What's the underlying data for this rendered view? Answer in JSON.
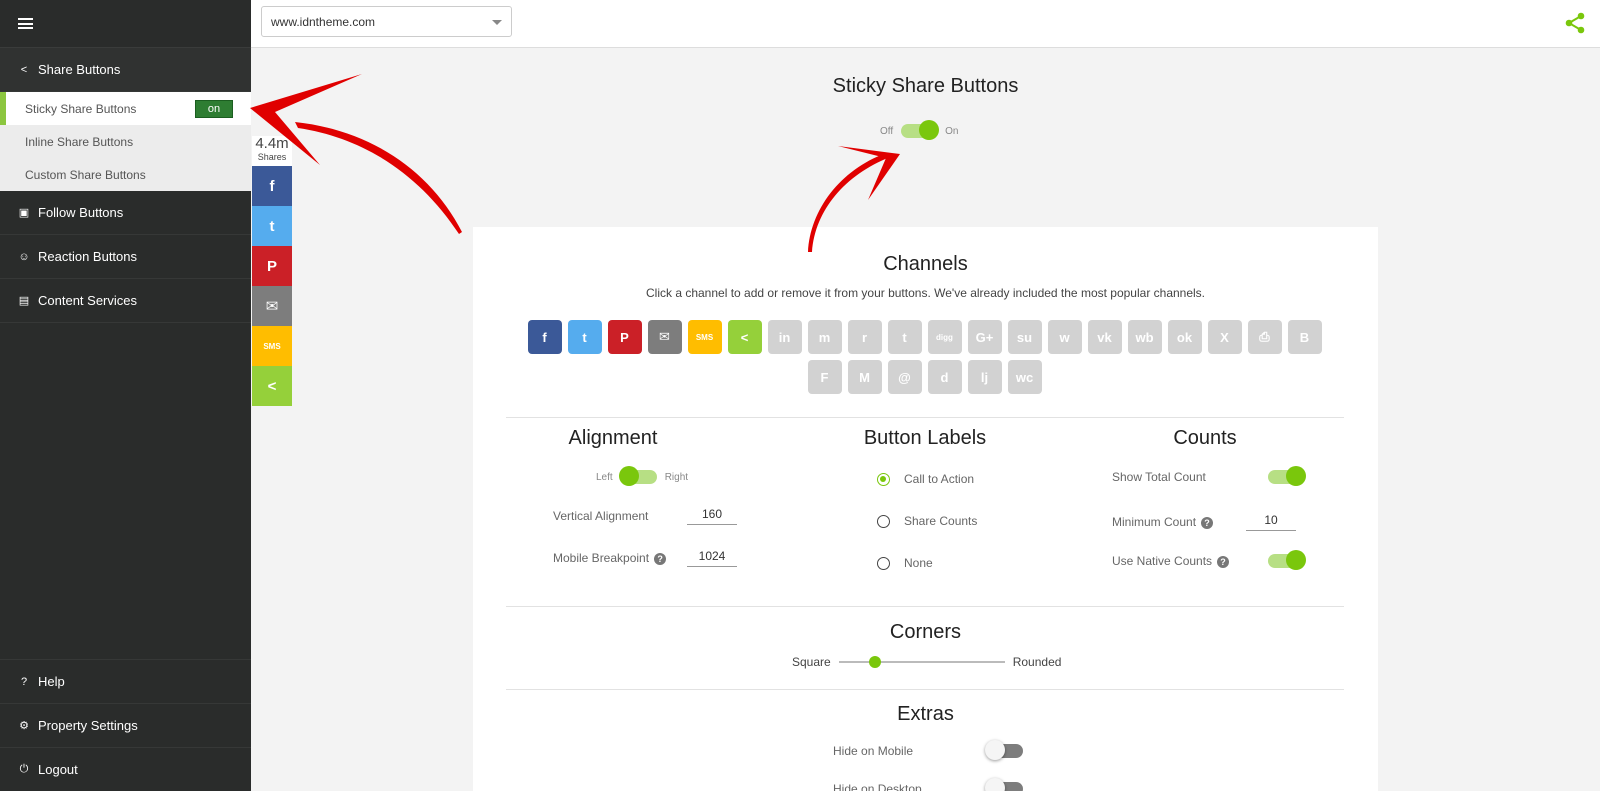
{
  "sidebar": {
    "share_buttons": "Share Buttons",
    "sub_items": [
      {
        "label": "Sticky Share Buttons",
        "badge": "on"
      },
      {
        "label": "Inline Share Buttons"
      },
      {
        "label": "Custom Share Buttons"
      }
    ],
    "follow_buttons": "Follow Buttons",
    "reaction_buttons": "Reaction Buttons",
    "content_services": "Content Services",
    "help": "Help",
    "property_settings": "Property Settings",
    "logout": "Logout"
  },
  "topbar": {
    "url": "www.idntheme.com"
  },
  "sticky_preview": {
    "count": "4.4m",
    "count_label": "Shares",
    "buttons": [
      {
        "icon": "facebook-icon",
        "glyph": "f",
        "color": "#3b5998"
      },
      {
        "icon": "twitter-icon",
        "glyph": "t",
        "color": "#55acee"
      },
      {
        "icon": "pinterest-icon",
        "glyph": "P",
        "color": "#cb2027"
      },
      {
        "icon": "email-icon",
        "glyph": "✉",
        "color": "#7d7d7d"
      },
      {
        "icon": "sms-icon",
        "glyph": "SMS",
        "color": "#ffbd00"
      },
      {
        "icon": "sharethis-icon",
        "glyph": "<",
        "color": "#95d03a"
      }
    ]
  },
  "main": {
    "title": "Sticky Share Buttons",
    "toggle_off": "Off",
    "toggle_on": "On"
  },
  "channels": {
    "title": "Channels",
    "subtitle": "Click a channel to add or remove it from your buttons. We've already included the most popular channels.",
    "items": [
      {
        "name": "facebook",
        "glyph": "f",
        "color": "#3b5998"
      },
      {
        "name": "twitter",
        "glyph": "t",
        "color": "#55acee"
      },
      {
        "name": "pinterest",
        "glyph": "P",
        "color": "#cb2027"
      },
      {
        "name": "email",
        "glyph": "✉",
        "color": "#7d7d7d"
      },
      {
        "name": "sms",
        "glyph": "SMS",
        "color": "#ffbd00"
      },
      {
        "name": "sharethis",
        "glyph": "<",
        "color": "#95d03a"
      },
      {
        "name": "linkedin",
        "glyph": "in",
        "color": "#d2d2d2"
      },
      {
        "name": "messenger",
        "glyph": "m",
        "color": "#d2d2d2"
      },
      {
        "name": "reddit",
        "glyph": "r",
        "color": "#d2d2d2"
      },
      {
        "name": "tumblr",
        "glyph": "t",
        "color": "#d2d2d2"
      },
      {
        "name": "digg",
        "glyph": "digg",
        "color": "#d2d2d2"
      },
      {
        "name": "googleplus",
        "glyph": "G+",
        "color": "#d2d2d2"
      },
      {
        "name": "stumbleupon",
        "glyph": "su",
        "color": "#d2d2d2"
      },
      {
        "name": "whatsapp",
        "glyph": "w",
        "color": "#d2d2d2"
      },
      {
        "name": "vk",
        "glyph": "vk",
        "color": "#d2d2d2"
      },
      {
        "name": "weibo",
        "glyph": "wb",
        "color": "#d2d2d2"
      },
      {
        "name": "odnoklassniki",
        "glyph": "ok",
        "color": "#d2d2d2"
      },
      {
        "name": "xing",
        "glyph": "X",
        "color": "#d2d2d2"
      },
      {
        "name": "print",
        "glyph": "⎙",
        "color": "#d2d2d2"
      },
      {
        "name": "blogger",
        "glyph": "B",
        "color": "#d2d2d2"
      },
      {
        "name": "flipboard",
        "glyph": "F",
        "color": "#d2d2d2"
      },
      {
        "name": "meneame",
        "glyph": "M",
        "color": "#d2d2d2"
      },
      {
        "name": "mailru",
        "glyph": "@",
        "color": "#d2d2d2"
      },
      {
        "name": "delicious",
        "glyph": "d",
        "color": "#d2d2d2"
      },
      {
        "name": "livejournal",
        "glyph": "lj",
        "color": "#d2d2d2"
      },
      {
        "name": "wechat",
        "glyph": "wc",
        "color": "#d2d2d2"
      }
    ]
  },
  "alignment": {
    "title": "Alignment",
    "left": "Left",
    "right": "Right",
    "vertical_label": "Vertical Alignment",
    "vertical_value": "160",
    "breakpoint_label": "Mobile Breakpoint",
    "breakpoint_value": "1024"
  },
  "button_labels": {
    "title": "Button Labels",
    "options": [
      "Call to Action",
      "Share Counts",
      "None"
    ],
    "selected": "Call to Action"
  },
  "counts": {
    "title": "Counts",
    "show_total": "Show Total Count",
    "minimum": "Minimum Count",
    "minimum_value": "10",
    "native": "Use Native Counts"
  },
  "corners": {
    "title": "Corners",
    "left": "Square",
    "right": "Rounded",
    "value_fraction": 0.22
  },
  "extras": {
    "title": "Extras",
    "hide_mobile": "Hide on Mobile",
    "hide_desktop": "Hide on Desktop"
  },
  "colors": {
    "accent": "#7ac70c",
    "sidebar": "#2a2c2b",
    "arrow": "#e00000"
  }
}
